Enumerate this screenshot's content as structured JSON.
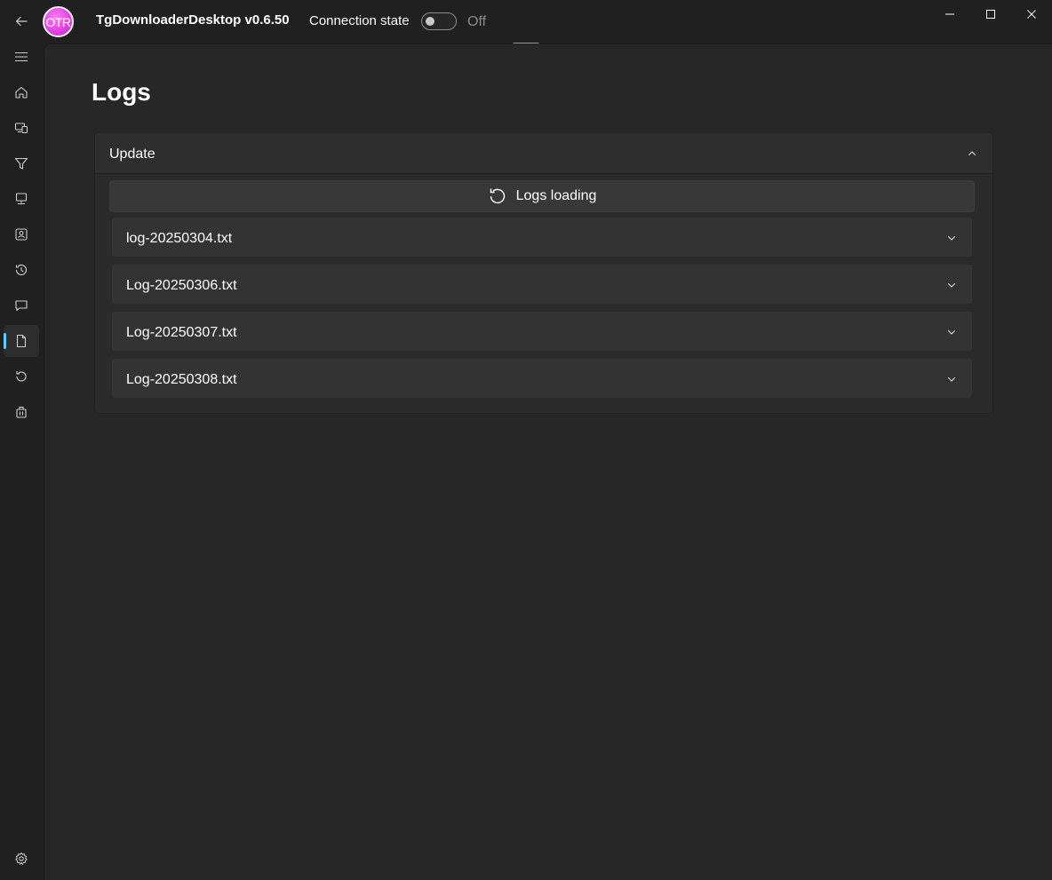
{
  "titlebar": {
    "logo_text": "OTR",
    "app_title": "TgDownloaderDesktop v0.6.50",
    "connection_label": "Connection state",
    "connection_toggle_state": "Off",
    "connection_on": false
  },
  "nav": {
    "items": [
      {
        "name": "menu",
        "icon": "hamburger-icon"
      },
      {
        "name": "home",
        "icon": "home-icon"
      },
      {
        "name": "clients",
        "icon": "devices-icon"
      },
      {
        "name": "filters",
        "icon": "filter-icon"
      },
      {
        "name": "desktop",
        "icon": "monitor-icon"
      },
      {
        "name": "contacts",
        "icon": "contact-card-icon"
      },
      {
        "name": "history",
        "icon": "history-icon"
      },
      {
        "name": "chats",
        "icon": "chat-icon"
      },
      {
        "name": "logs",
        "icon": "document-icon",
        "selected": true
      },
      {
        "name": "update",
        "icon": "refresh-icon"
      },
      {
        "name": "license",
        "icon": "briefcase-icon"
      }
    ],
    "settings_icon": "gear-icon"
  },
  "main": {
    "page_title": "Logs",
    "expander": {
      "title": "Update",
      "expanded": true,
      "load_button_label": "Logs loading",
      "log_files": [
        {
          "name": "log-20250304.txt"
        },
        {
          "name": "Log-20250306.txt"
        },
        {
          "name": "Log-20250307.txt"
        },
        {
          "name": "Log-20250308.txt"
        }
      ]
    }
  },
  "colors": {
    "background": "#202020",
    "content_background": "#272727",
    "accent": "#60cdff",
    "logo": "#e040e0"
  }
}
